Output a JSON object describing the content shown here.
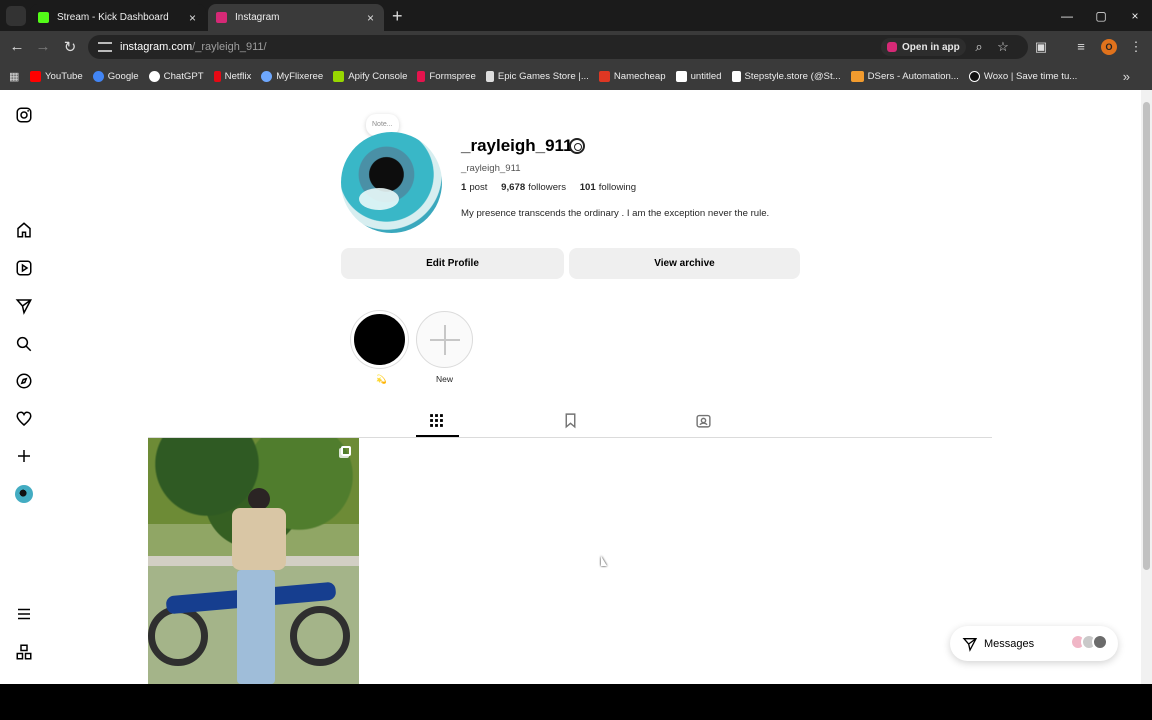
{
  "browser": {
    "tabs": [
      {
        "label": "Stream - Kick Dashboard",
        "favicon_color": "#53fc18"
      },
      {
        "label": "Instagram",
        "favicon_color": "#d62976"
      }
    ],
    "url": {
      "domain": "instagram.com",
      "path": "/_rayleigh_911/"
    },
    "open_in_app_label": "Open in app",
    "profile_initial": "O",
    "bookmarks": [
      {
        "label": "YouTube",
        "color": "#ff0000"
      },
      {
        "label": "Google",
        "color": "#4285f4"
      },
      {
        "label": "ChatGPT",
        "color": "#ffffff"
      },
      {
        "label": "Netflix",
        "color": "#e50914"
      },
      {
        "label": "MyFlixeree",
        "color": "#6ea8fe"
      },
      {
        "label": "Apify Console",
        "color": "#97d700"
      },
      {
        "label": "Formspree",
        "color": "#e5134d"
      },
      {
        "label": "Epic Games Store |...",
        "color": "#dddddd"
      },
      {
        "label": "Namecheap",
        "color": "#de3723"
      },
      {
        "label": "untitled",
        "color": "#ffffff"
      },
      {
        "label": "Stepstyle.store (@St...",
        "color": "#ffffff"
      },
      {
        "label": "DSers - Automation...",
        "color": "#f29b2e"
      },
      {
        "label": "Woxo | Save time tu...",
        "color": "#111111"
      }
    ]
  },
  "profile": {
    "note_placeholder": "Note...",
    "username": "_rayleigh_911",
    "full_name": "_rayleigh_911",
    "posts_count": "1",
    "posts_label": "post",
    "followers_count": "9,678",
    "followers_label": "followers",
    "following_count": "101",
    "following_label": "following",
    "bio": "My presence transcends the ordinary . I am the exception never the rule.",
    "buttons": {
      "edit": "Edit Profile",
      "archive": "View archive"
    },
    "highlights": [
      {
        "label": "💫"
      },
      {
        "label": "New"
      }
    ],
    "messages_label": "Messages"
  },
  "colors": {
    "chrome_dark": "#1f1f1f",
    "instagram_text": "#262626",
    "button_gray": "#efefef"
  }
}
